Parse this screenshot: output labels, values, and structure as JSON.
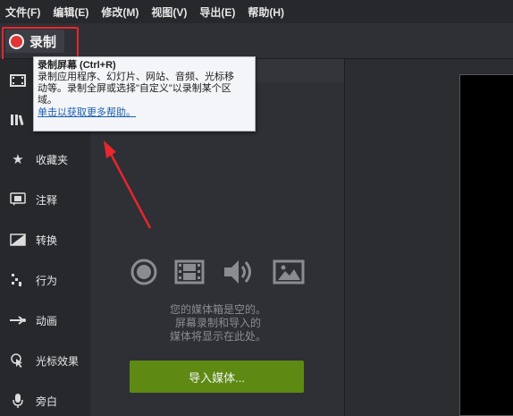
{
  "menu": {
    "items": [
      "文件(F)",
      "编辑(E)",
      "修改(M)",
      "视图(V)",
      "导出(E)",
      "帮助(H)"
    ]
  },
  "toolbar": {
    "record_label": "录制"
  },
  "tooltip": {
    "title": "录制屏幕 (Ctrl+R)",
    "description_1": "录制应用程序、幻灯片、网站、音频、光标移",
    "description_2": "动等。录制全屏或选择\"自定义\"以录制某个区",
    "description_3": "域。",
    "link": "单击以获取更多帮助。"
  },
  "sidebar": {
    "items": [
      {
        "label": "",
        "icon": "film-icon"
      },
      {
        "label": "",
        "icon": "library-icon"
      },
      {
        "label": "收藏夹",
        "icon": "star-icon"
      },
      {
        "label": "注释",
        "icon": "annotation-icon"
      },
      {
        "label": "转换",
        "icon": "transition-icon"
      },
      {
        "label": "行为",
        "icon": "behavior-icon"
      },
      {
        "label": "动画",
        "icon": "animation-icon"
      },
      {
        "label": "光标效果",
        "icon": "cursor-effect-icon"
      },
      {
        "label": "旁白",
        "icon": "microphone-icon"
      }
    ]
  },
  "media_bin": {
    "empty_line_1": "您的媒体箱是空的。",
    "empty_line_2": "屏幕录制和导入的",
    "empty_line_3": "媒体将显示在此处。",
    "import_label": "导入媒体..."
  },
  "colors": {
    "record_red": "#e03535",
    "highlight_red": "#e8262b",
    "import_green": "#5e8a14",
    "link_blue": "#1a5fb4"
  }
}
